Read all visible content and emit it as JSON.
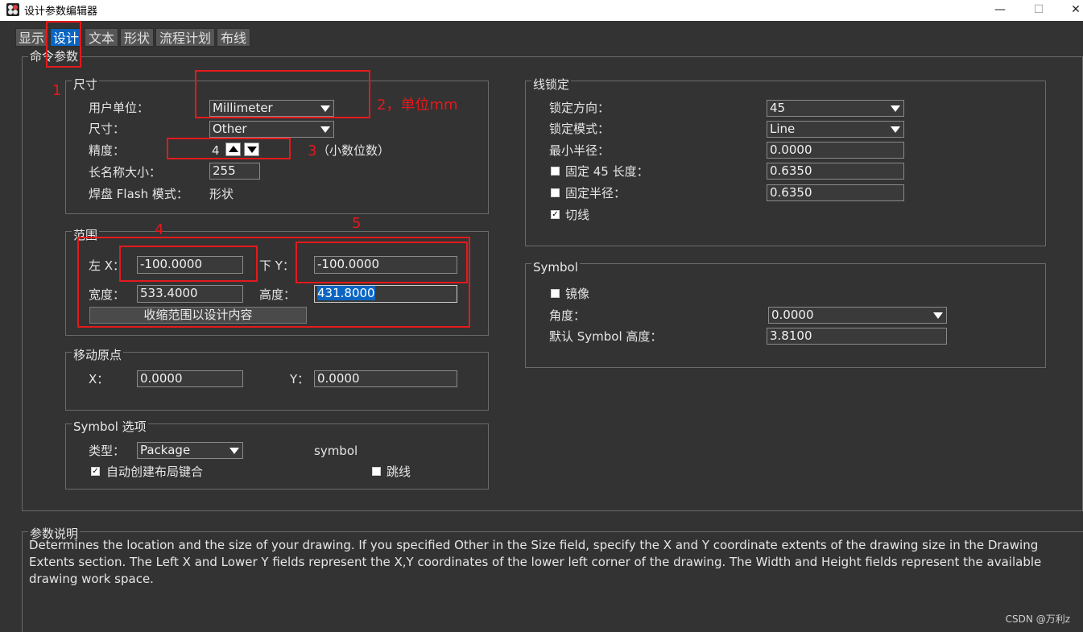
{
  "window": {
    "title": "设计参数编辑器",
    "minimize": "—",
    "maximize": "☐",
    "close": "✕"
  },
  "tabs": [
    {
      "label": "显示",
      "active": false
    },
    {
      "label": "设计",
      "active": true
    },
    {
      "label": "文本",
      "active": false
    },
    {
      "label": "形状",
      "active": false
    },
    {
      "label": "流程计划",
      "active": false
    },
    {
      "label": "布线",
      "active": false
    }
  ],
  "command_params": {
    "title": "命令参数",
    "size_group": {
      "title": "尺寸",
      "user_units_label": "用户单位：",
      "user_units_value": "Millimeter",
      "size_label": "尺寸：",
      "size_value": "Other",
      "accuracy_label": "精度：",
      "accuracy_value": "4",
      "long_name_label": "长名称大小：",
      "long_name_value": "255",
      "pad_flash_label": "焊盘 Flash 模式：",
      "pad_flash_value": "形状"
    },
    "extents_group": {
      "title": "范围",
      "left_x_label": "左 X：",
      "left_x_value": "-100.0000",
      "lower_y_label": "下 Y：",
      "lower_y_value": "-100.0000",
      "width_label": "宽度：",
      "width_value": "533.4000",
      "height_label": "高度：",
      "height_value": "431.8000",
      "shrink_button": "收缩范围以设计内容"
    },
    "move_origin_group": {
      "title": "移动原点",
      "x_label": "X：",
      "x_value": "0.0000",
      "y_label": "Y：",
      "y_value": "0.0000"
    },
    "symbol_options_group": {
      "title": "Symbol 选项",
      "type_label": "类型：",
      "type_value": "Package",
      "type_suffix": "symbol",
      "auto_create_label": "自动创建布局键合",
      "auto_create_checked": true,
      "jumper_label": "跳线",
      "jumper_checked": false
    },
    "line_lock_group": {
      "title": "线锁定",
      "lock_dir_label": "锁定方向：",
      "lock_dir_value": "45",
      "lock_mode_label": "锁定模式：",
      "lock_mode_value": "Line",
      "min_radius_label": "最小半径：",
      "min_radius_value": "0.0000",
      "fixed45_label": "固定 45 长度：",
      "fixed45_checked": false,
      "fixed45_value": "0.6350",
      "fixed_radius_label": "固定半径：",
      "fixed_radius_checked": false,
      "fixed_radius_value": "0.6350",
      "tangent_label": "切线",
      "tangent_checked": true
    },
    "symbol_group": {
      "title": "Symbol",
      "mirror_label": "镜像",
      "mirror_checked": false,
      "angle_label": "角度：",
      "angle_value": "0.0000",
      "default_height_label": "默认 Symbol 高度：",
      "default_height_value": "3.8100"
    }
  },
  "description": {
    "title": "参数说明",
    "text": "Determines the location and the size of your drawing. If you specified Other in the Size field, specify the X and Y coordinate extents of the drawing size in the Drawing Extents section. The Left X and Lower Y fields represent the X,Y coordinates of the lower left corner of the drawing. The Width and Height fields represent the available drawing work space."
  },
  "annotations": {
    "n1": "1",
    "n2": "2，单位mm",
    "n3": "3",
    "n3_note": "（小数位数）",
    "n4": "4",
    "n5": "5",
    "color": "#e5191c"
  },
  "watermark": "CSDN @万利z",
  "check_mark": "✓",
  "colors": {
    "accent": "#0a64c2",
    "background": "#333333"
  }
}
